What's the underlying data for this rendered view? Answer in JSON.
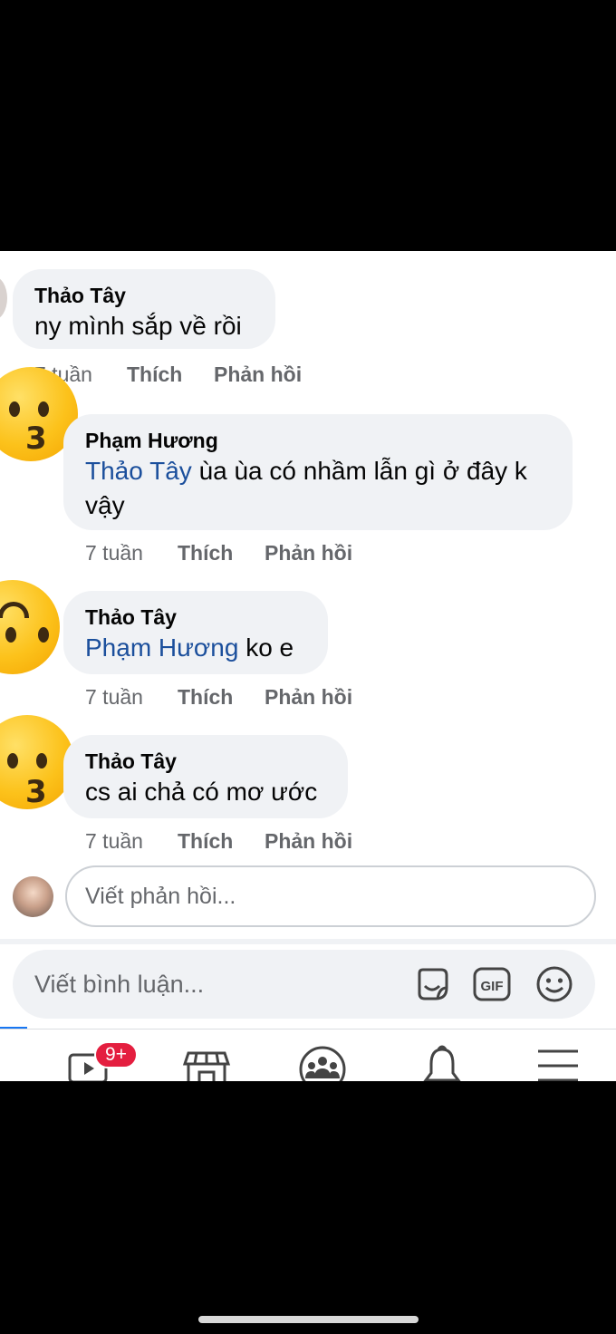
{
  "thread": {
    "comments": [
      {
        "author": "Thảo Tây",
        "mention": "",
        "text": "ny mình sắp về rồi",
        "time": "7 tuần",
        "like": "Thích",
        "reply": "Phản hồi"
      },
      {
        "author": "Phạm Hương",
        "mention": "Thảo Tây",
        "text": "ùa ùa có nhầm lẫn gì ở đây k vậy",
        "time": "7 tuần",
        "like": "Thích",
        "reply": "Phản hồi"
      },
      {
        "author": "Thảo Tây",
        "mention": "Phạm Hương",
        "text": "ko e",
        "time": "7 tuần",
        "like": "Thích",
        "reply": "Phản hồi"
      },
      {
        "author": "Thảo Tây",
        "mention": "",
        "text": "cs ai chả có mơ ước",
        "time": "7 tuần",
        "like": "Thích",
        "reply": "Phản hồi"
      }
    ],
    "avatars": [
      "kissing-face-emoji",
      "upside-down-face-emoji",
      "kissing-face-emoji"
    ]
  },
  "reply_box": {
    "placeholder": "Viết phản hồi..."
  },
  "comment_box": {
    "placeholder": "Viết bình luận...",
    "icons": [
      "sticker-icon",
      "gif-icon",
      "emoji-icon"
    ],
    "gif_label": "GIF"
  },
  "bottom_nav": {
    "items": [
      "video-icon",
      "marketplace-icon",
      "groups-icon",
      "notifications-icon",
      "menu-icon"
    ],
    "video_badge": "9+"
  },
  "colors": {
    "mention": "#1b4f9c",
    "bubble": "#f0f2f5",
    "meta_text": "#65676b",
    "badge": "#e41e3f"
  }
}
